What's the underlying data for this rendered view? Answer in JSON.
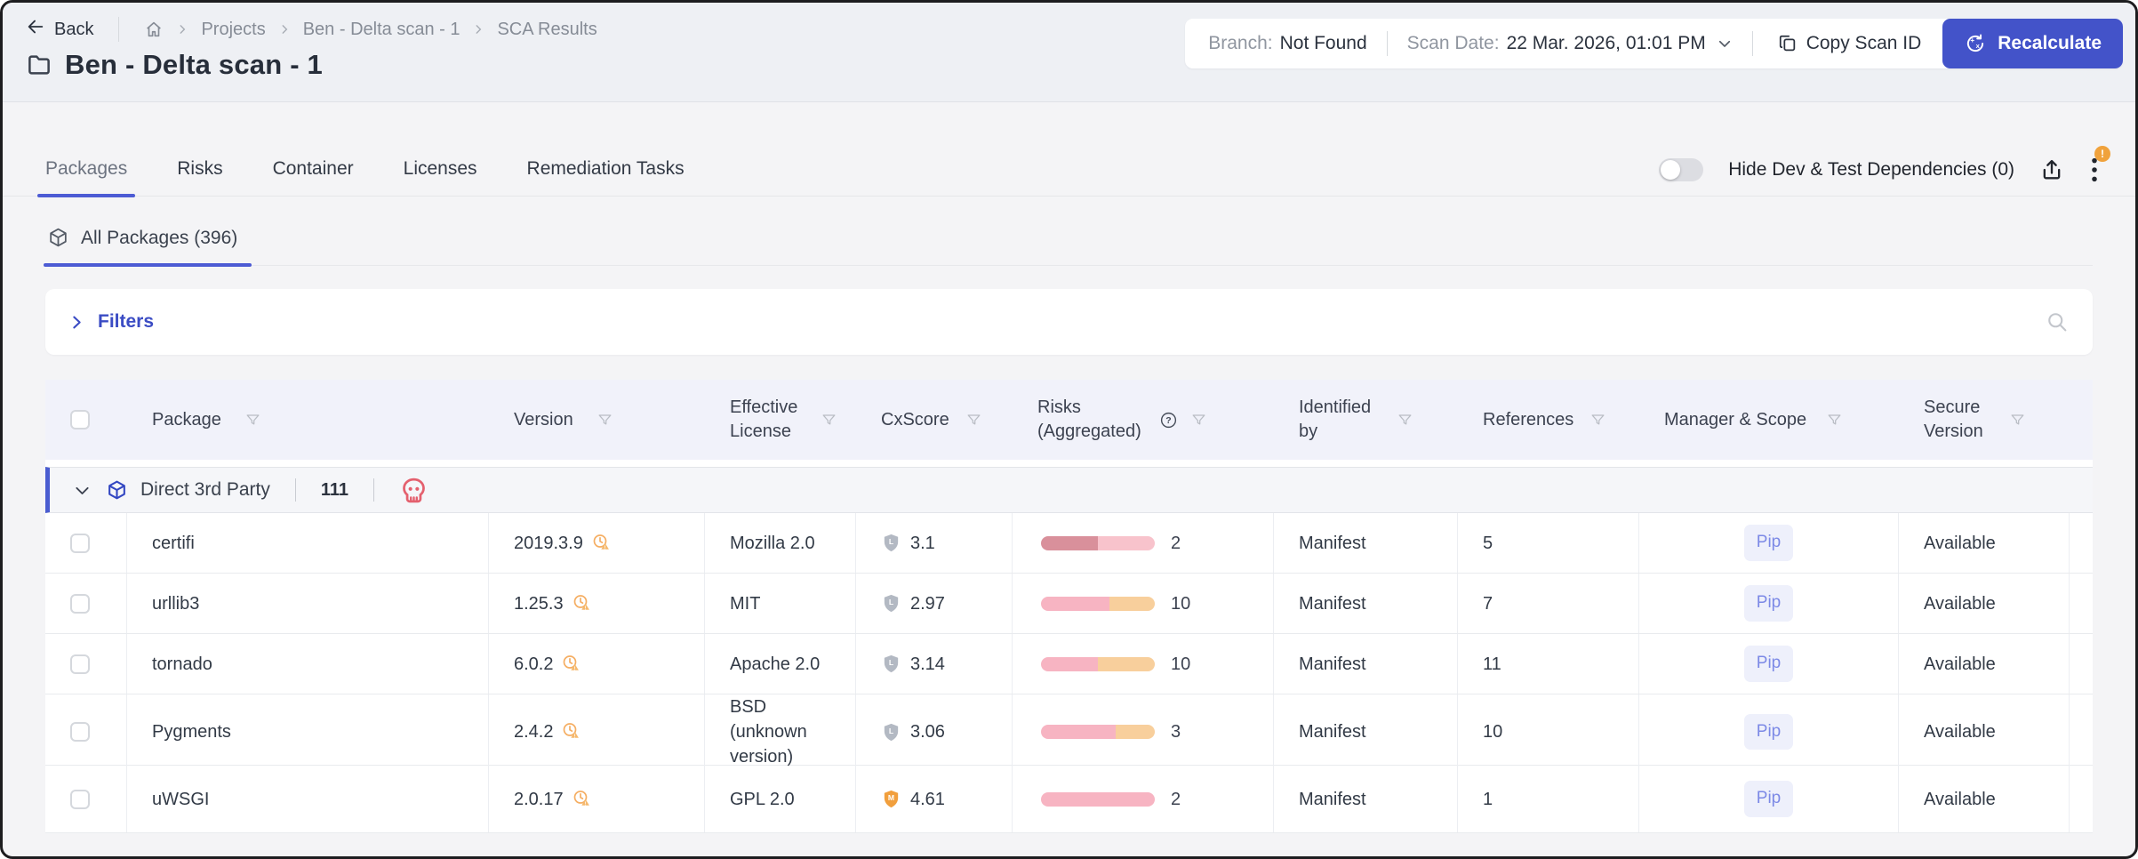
{
  "header": {
    "back": "Back",
    "breadcrumbs": [
      "Projects",
      "Ben - Delta scan - 1",
      "SCA Results"
    ],
    "title": "Ben - Delta scan - 1",
    "branch_label": "Branch:",
    "branch_value": "Not Found",
    "scan_date_label": "Scan Date:",
    "scan_date_value": "22 Mar. 2026, 01:01 PM",
    "copy_scan_id_label": "Copy Scan ID",
    "recalculate_label": "Recalculate"
  },
  "tabs": {
    "items": [
      {
        "label": "Packages",
        "active": true
      },
      {
        "label": "Risks",
        "active": false
      },
      {
        "label": "Container",
        "active": false
      },
      {
        "label": "Licenses",
        "active": false
      },
      {
        "label": "Remediation Tasks",
        "active": false
      }
    ]
  },
  "toolbar": {
    "hide_toggle_label": "Hide Dev & Test Dependencies (0)",
    "toggle_state": "off",
    "menu_badge": "!"
  },
  "packages_tab": {
    "label": "All Packages (396)"
  },
  "filters": {
    "label": "Filters"
  },
  "table": {
    "columns": {
      "package": "Package",
      "version": "Version",
      "license": "Effective License",
      "cxscore": "CxScore",
      "risks": "Risks (Aggregated)",
      "identified": "Identified by",
      "references": "References",
      "manager": "Manager & Scope",
      "secure": "Secure Version"
    },
    "group": {
      "label": "Direct 3rd Party",
      "count": "111"
    },
    "rows": [
      {
        "package": "certifi",
        "version": "2019.3.9",
        "license": "Mozilla 2.0",
        "severity": "L",
        "severity_color": "#b3b9c3",
        "cxscore": "3.1",
        "risk_segments": [
          {
            "color": "#d9909b",
            "pct": 50
          },
          {
            "color": "#f8c3cc",
            "pct": 50
          }
        ],
        "risks_count": "2",
        "identified_by": "Manifest",
        "references": "5",
        "manager": "Pip",
        "secure_version": "Available"
      },
      {
        "package": "urllib3",
        "version": "1.25.3",
        "license": "MIT",
        "severity": "L",
        "severity_color": "#b3b9c3",
        "cxscore": "2.97",
        "risk_segments": [
          {
            "color": "#f7b4c2",
            "pct": 60
          },
          {
            "color": "#f8cf9c",
            "pct": 40
          }
        ],
        "risks_count": "10",
        "identified_by": "Manifest",
        "references": "7",
        "manager": "Pip",
        "secure_version": "Available"
      },
      {
        "package": "tornado",
        "version": "6.0.2",
        "license": "Apache 2.0",
        "severity": "L",
        "severity_color": "#b3b9c3",
        "cxscore": "3.14",
        "risk_segments": [
          {
            "color": "#f7b4c2",
            "pct": 50
          },
          {
            "color": "#f8cf9c",
            "pct": 50
          }
        ],
        "risks_count": "10",
        "identified_by": "Manifest",
        "references": "11",
        "manager": "Pip",
        "secure_version": "Available"
      },
      {
        "package": "Pygments",
        "version": "2.4.2",
        "license": "BSD (unknown version)",
        "severity": "L",
        "severity_color": "#b3b9c3",
        "cxscore": "3.06",
        "risk_segments": [
          {
            "color": "#f7b4c2",
            "pct": 66
          },
          {
            "color": "#f8cf9c",
            "pct": 34
          }
        ],
        "risks_count": "3",
        "identified_by": "Manifest",
        "references": "10",
        "manager": "Pip",
        "secure_version": "Available"
      },
      {
        "package": "uWSGI",
        "version": "2.0.17",
        "license": "GPL 2.0",
        "severity": "M",
        "severity_color": "#f19f3d",
        "cxscore": "4.61",
        "risk_segments": [
          {
            "color": "#f7b4c2",
            "pct": 100
          }
        ],
        "risks_count": "2",
        "identified_by": "Manifest",
        "references": "1",
        "manager": "Pip",
        "secure_version": "Available"
      }
    ]
  },
  "icons": {
    "back": "left-arrow",
    "home": "house",
    "breadcrumb-sep": "chevron-right",
    "project": "folder",
    "scan-date-caret": "chevron-down",
    "copy": "copy",
    "recalculate": "circular-arrows",
    "export": "upload",
    "menu": "kebab-dots",
    "package": "cube",
    "filters-caret": "chevron-right",
    "search": "magnifier",
    "filter": "funnel",
    "help": "question-circle",
    "severity": "shield-letter",
    "outdated-version": "clock-warning",
    "malicious": "skull"
  },
  "colors": {
    "accent": "#4353c9",
    "tab_underline": "#4c5bd4",
    "header_row_bg": "#f1f2fa",
    "risk_high": "#d9909b",
    "risk_medium": "#f7b4c2",
    "risk_low": "#f8cf9c",
    "severity_low": "#b3b9c3",
    "severity_medium": "#f19f3d",
    "warning": "#f5a93f",
    "danger": "#e4606e",
    "badge": "#f0a23c"
  }
}
